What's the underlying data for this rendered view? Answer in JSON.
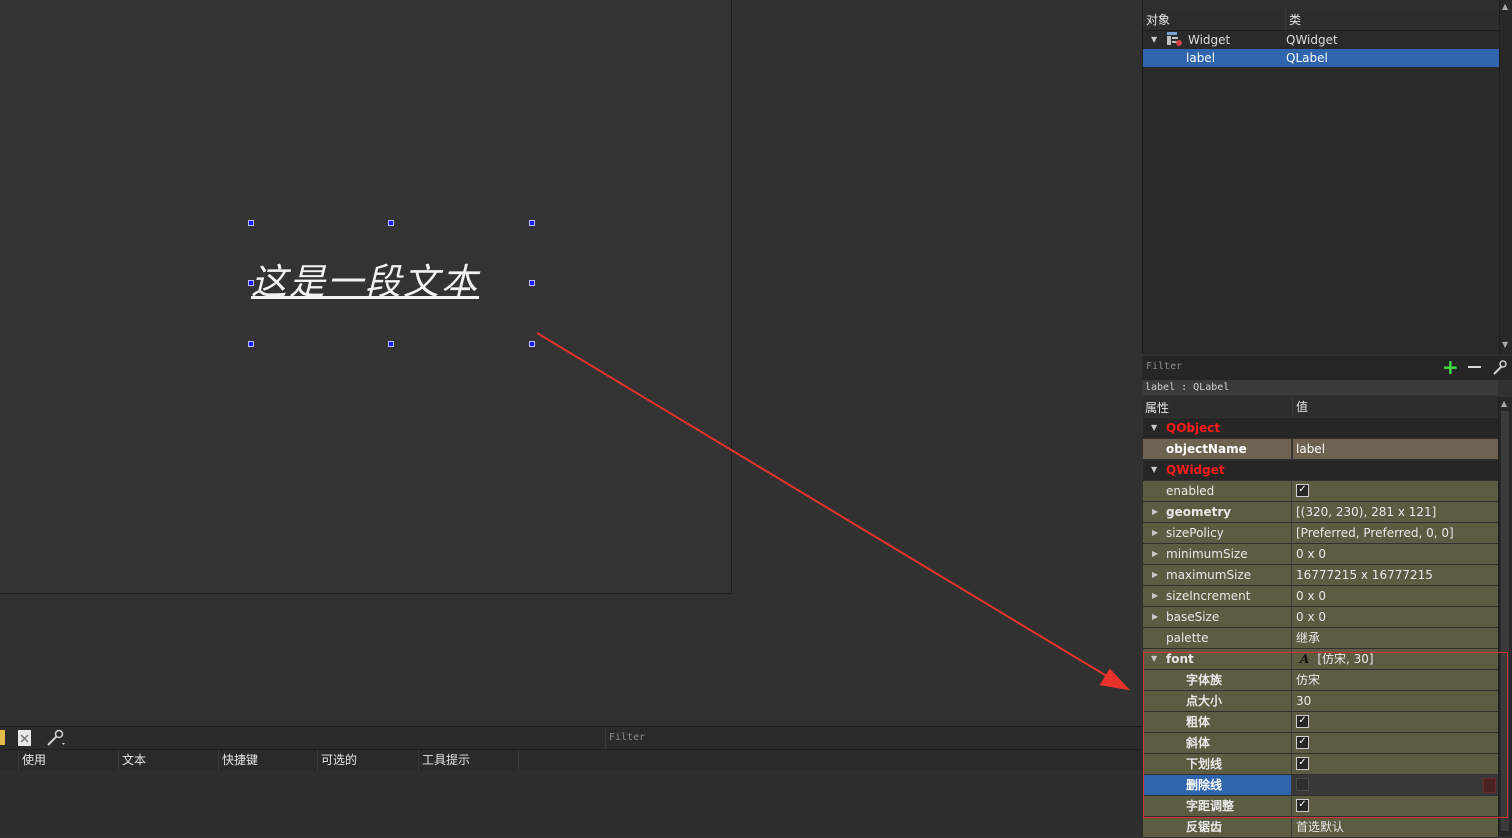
{
  "designer": {
    "label_text": "这是一段文本"
  },
  "object_inspector": {
    "col_object": "对象",
    "col_class": "类",
    "rows": [
      {
        "name": "Widget",
        "class": "QWidget"
      },
      {
        "name": "label",
        "class": "QLabel"
      }
    ]
  },
  "property_editor": {
    "filter_placeholder": "Filter",
    "title": "label : QLabel",
    "col_property": "属性",
    "col_value": "值",
    "categories": {
      "qobject": "QObject",
      "qwidget": "QWidget"
    },
    "rows": {
      "objectName": {
        "name": "objectName",
        "value": "label"
      },
      "enabled": {
        "name": "enabled",
        "check": "✓"
      },
      "geometry": {
        "name": "geometry",
        "value": "[(320, 230), 281 x 121]"
      },
      "sizePolicy": {
        "name": "sizePolicy",
        "value": "[Preferred, Preferred, 0, 0]"
      },
      "minimumSize": {
        "name": "minimumSize",
        "value": "0 x 0"
      },
      "maximumSize": {
        "name": "maximumSize",
        "value": "16777215 x 16777215"
      },
      "sizeIncrement": {
        "name": "sizeIncrement",
        "value": "0 x 0"
      },
      "baseSize": {
        "name": "baseSize",
        "value": "0 x 0"
      },
      "palette": {
        "name": "palette",
        "value": "继承"
      },
      "font": {
        "name": "font",
        "value": "[仿宋, 30]"
      },
      "family": {
        "name": "字体族",
        "value": "仿宋"
      },
      "pointSize": {
        "name": "点大小",
        "value": "30"
      },
      "bold": {
        "name": "粗体",
        "check": "✓"
      },
      "italic": {
        "name": "斜体",
        "check": "✓"
      },
      "underline": {
        "name": "下划线",
        "check": "✓"
      },
      "strikeout": {
        "name": "删除线"
      },
      "kerning": {
        "name": "字距调整",
        "check": "✓"
      },
      "antialiasing": {
        "name": "反锯齿",
        "value": "首选默认"
      }
    }
  },
  "action_editor": {
    "filter_placeholder": "Filter",
    "columns": [
      "使用",
      "文本",
      "快捷键",
      "可选的",
      "工具提示"
    ]
  },
  "colors": {
    "accent_red": "#ff1a1a",
    "selection": "#2f65ad",
    "olive": "#5c5c42"
  }
}
